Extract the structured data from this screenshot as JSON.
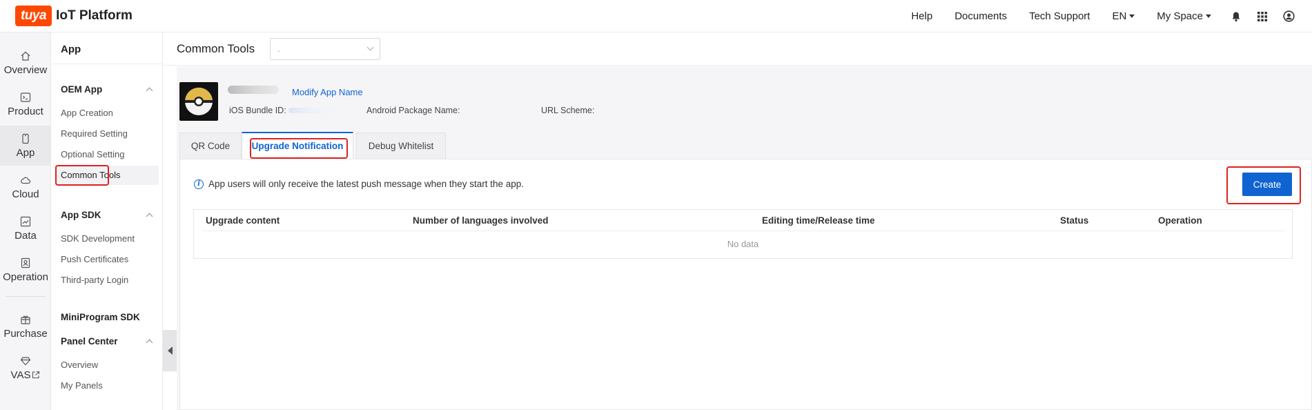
{
  "topbar": {
    "logo_text": "tuya",
    "brand": "IoT Platform",
    "nav": [
      "Help",
      "Documents",
      "Tech Support"
    ],
    "language": "EN",
    "space": "My Space"
  },
  "rail": [
    {
      "label": "Overview",
      "icon": "home-icon"
    },
    {
      "label": "Product",
      "icon": "terminal-icon"
    },
    {
      "label": "App",
      "icon": "phone-icon"
    },
    {
      "label": "Cloud",
      "icon": "cloud-icon"
    },
    {
      "label": "Data",
      "icon": "chart-icon"
    },
    {
      "label": "Operation",
      "icon": "badge-icon"
    },
    {
      "label": "Purchase",
      "icon": "gift-icon"
    },
    {
      "label": "VAS",
      "icon": "diamond-icon"
    }
  ],
  "submenu": {
    "title": "App",
    "groups": [
      {
        "title": "OEM App",
        "items": [
          "App Creation",
          "Required Setting",
          "Optional Setting",
          "Common Tools"
        ]
      },
      {
        "title": "App SDK",
        "items": [
          "SDK Development",
          "Push Certificates",
          "Third-party Login"
        ]
      },
      {
        "title": "MiniProgram SDK",
        "items": []
      },
      {
        "title": "Panel Center",
        "items": [
          "Overview",
          "My Panels"
        ]
      }
    ]
  },
  "content": {
    "title": "Common Tools",
    "select_value": ".",
    "modify_link": "Modify App Name",
    "ios_label": "iOS Bundle ID:",
    "android_label": "Android Package Name:",
    "url_label": "URL Scheme:",
    "tabs": [
      "QR Code",
      "Upgrade Notification",
      "Debug Whitelist"
    ],
    "info": "App users will only receive the latest push message when they start the app.",
    "create": "Create",
    "columns": [
      "Upgrade content",
      "Number of languages involved",
      "Editing time/Release time",
      "Status",
      "Operation"
    ],
    "empty": "No data"
  }
}
